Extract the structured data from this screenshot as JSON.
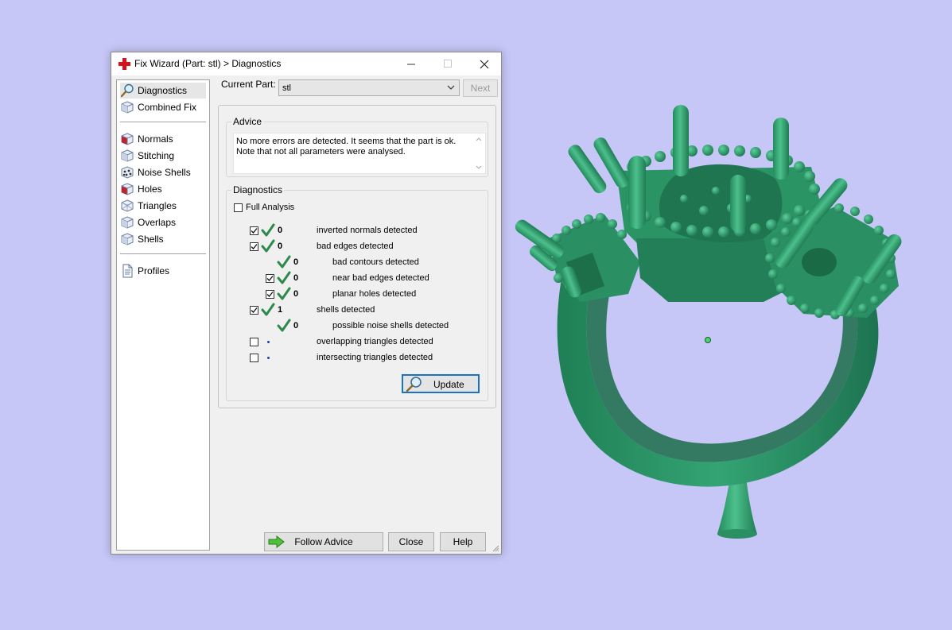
{
  "window": {
    "title": "Fix Wizard (Part: stl) > Diagnostics",
    "controls": {
      "minimize": "—",
      "maximize": "☐",
      "close": "✕"
    }
  },
  "sidebar": {
    "groups": [
      [
        {
          "label": "Diagnostics",
          "icon": "magnifier-icon",
          "selected": true
        },
        {
          "label": "Combined Fix",
          "icon": "cube-icon"
        }
      ],
      [
        {
          "label": "Normals",
          "icon": "cube-red-face-icon"
        },
        {
          "label": "Stitching",
          "icon": "cube-icon"
        },
        {
          "label": "Noise Shells",
          "icon": "dotted-cube-icon"
        },
        {
          "label": "Holes",
          "icon": "cube-red-face-icon"
        },
        {
          "label": "Triangles",
          "icon": "wire-cube-icon"
        },
        {
          "label": "Overlaps",
          "icon": "cube-icon"
        },
        {
          "label": "Shells",
          "icon": "cube-icon"
        }
      ],
      [
        {
          "label": "Profiles",
          "icon": "document-icon"
        }
      ]
    ]
  },
  "current_part": {
    "label": "Current Part:",
    "value": "stl",
    "next": "Next"
  },
  "advice": {
    "title": "Advice",
    "text": "No more errors are detected. It seems that the part is ok. Note that not all parameters were analysed."
  },
  "diagnostics": {
    "title": "Diagnostics",
    "full_analysis": "Full Analysis",
    "rows": [
      {
        "checkbox": true,
        "checked": true,
        "ok": true,
        "count": "0",
        "label": "inverted normals detected",
        "indent": 0
      },
      {
        "checkbox": true,
        "checked": true,
        "ok": true,
        "count": "0",
        "label": "bad edges detected",
        "indent": 0
      },
      {
        "checkbox": false,
        "checked": false,
        "ok": true,
        "count": "0",
        "label": "bad contours detected",
        "indent": 1
      },
      {
        "checkbox": true,
        "checked": true,
        "ok": true,
        "count": "0",
        "label": "near bad edges detected",
        "indent": 1
      },
      {
        "checkbox": true,
        "checked": true,
        "ok": true,
        "count": "0",
        "label": "planar holes detected",
        "indent": 1
      },
      {
        "checkbox": true,
        "checked": true,
        "ok": true,
        "count": "1",
        "label": "shells detected",
        "indent": 0
      },
      {
        "checkbox": false,
        "checked": false,
        "ok": true,
        "count": "0",
        "label": "possible noise shells detected",
        "indent": 1
      },
      {
        "checkbox": true,
        "checked": false,
        "ok": false,
        "count": "",
        "label": "overlapping triangles detected",
        "indent": 0
      },
      {
        "checkbox": true,
        "checked": false,
        "ok": false,
        "count": "",
        "label": "intersecting triangles detected",
        "indent": 0
      }
    ],
    "update": "Update"
  },
  "footer": {
    "follow_advice": "Follow Advice",
    "close": "Close",
    "help": "Help"
  },
  "colors": {
    "background": "#c6c6f7",
    "model": "#2f9a6c",
    "check": "#2d8a4a",
    "focus": "#1a72c2"
  }
}
